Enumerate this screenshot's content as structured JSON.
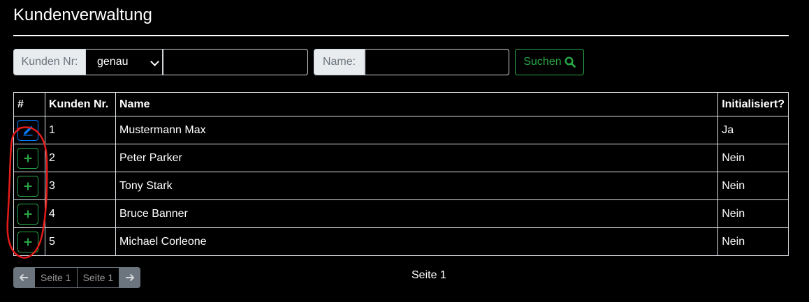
{
  "title": "Kundenverwaltung",
  "search": {
    "customer_no_label": "Kunden Nr:",
    "match_mode": "genau",
    "customer_no_value": "",
    "name_label": "Name:",
    "name_value": "",
    "search_button": "Suchen"
  },
  "table": {
    "headers": [
      "#",
      "Kunden Nr.",
      "Name",
      "Initialisiert?"
    ],
    "rows": [
      {
        "action": "edit",
        "number": "1",
        "name": "Mustermann Max",
        "initialized": "Ja"
      },
      {
        "action": "add",
        "number": "2",
        "name": "Peter Parker",
        "initialized": "Nein"
      },
      {
        "action": "add",
        "number": "3",
        "name": "Tony Stark",
        "initialized": "Nein"
      },
      {
        "action": "add",
        "number": "4",
        "name": "Bruce Banner",
        "initialized": "Nein"
      },
      {
        "action": "add",
        "number": "5",
        "name": "Michael Corleone",
        "initialized": "Nein"
      }
    ]
  },
  "pagination": {
    "pages": [
      "Seite 1",
      "Seite 1"
    ],
    "current_label": "Seite 1"
  },
  "colors": {
    "accent_green": "#28a745",
    "accent_blue": "#007bff",
    "annotation_red": "#e31b1b"
  }
}
